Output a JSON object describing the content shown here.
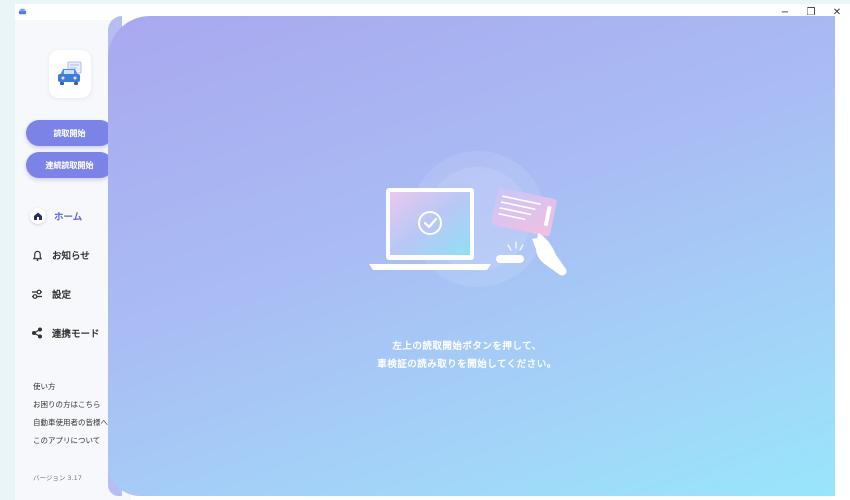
{
  "window": {
    "minimize_glyph": "−",
    "maximize_glyph": "❐",
    "close_glyph": "✕"
  },
  "sidebar": {
    "logo_icon": "car-document-icon",
    "read_start_label": "読取開始",
    "continuous_read_label": "連続読取開始",
    "nav": [
      {
        "label": "ホーム",
        "icon": "home-icon",
        "active": true
      },
      {
        "label": "お知らせ",
        "icon": "bell-icon",
        "active": false
      },
      {
        "label": "設定",
        "icon": "sliders-icon",
        "active": false
      },
      {
        "label": "連携モード",
        "icon": "share-icon",
        "active": false
      }
    ],
    "links": [
      {
        "label": "使い方"
      },
      {
        "label": "お困りの方はこちら"
      },
      {
        "label": "自動車使用者の皆様へ"
      },
      {
        "label": "このアプリについて"
      }
    ],
    "version": "バージョン  3.17"
  },
  "main": {
    "message_line1": "左上の読取開始ボタンを押して、",
    "message_line2": "車検証の読み取りを開始してください。"
  },
  "colors": {
    "accent": "#7b83e7",
    "active_nav": "#5b63d6",
    "gradient_top": "#a9a8ef",
    "gradient_bottom": "#98e6fb"
  }
}
